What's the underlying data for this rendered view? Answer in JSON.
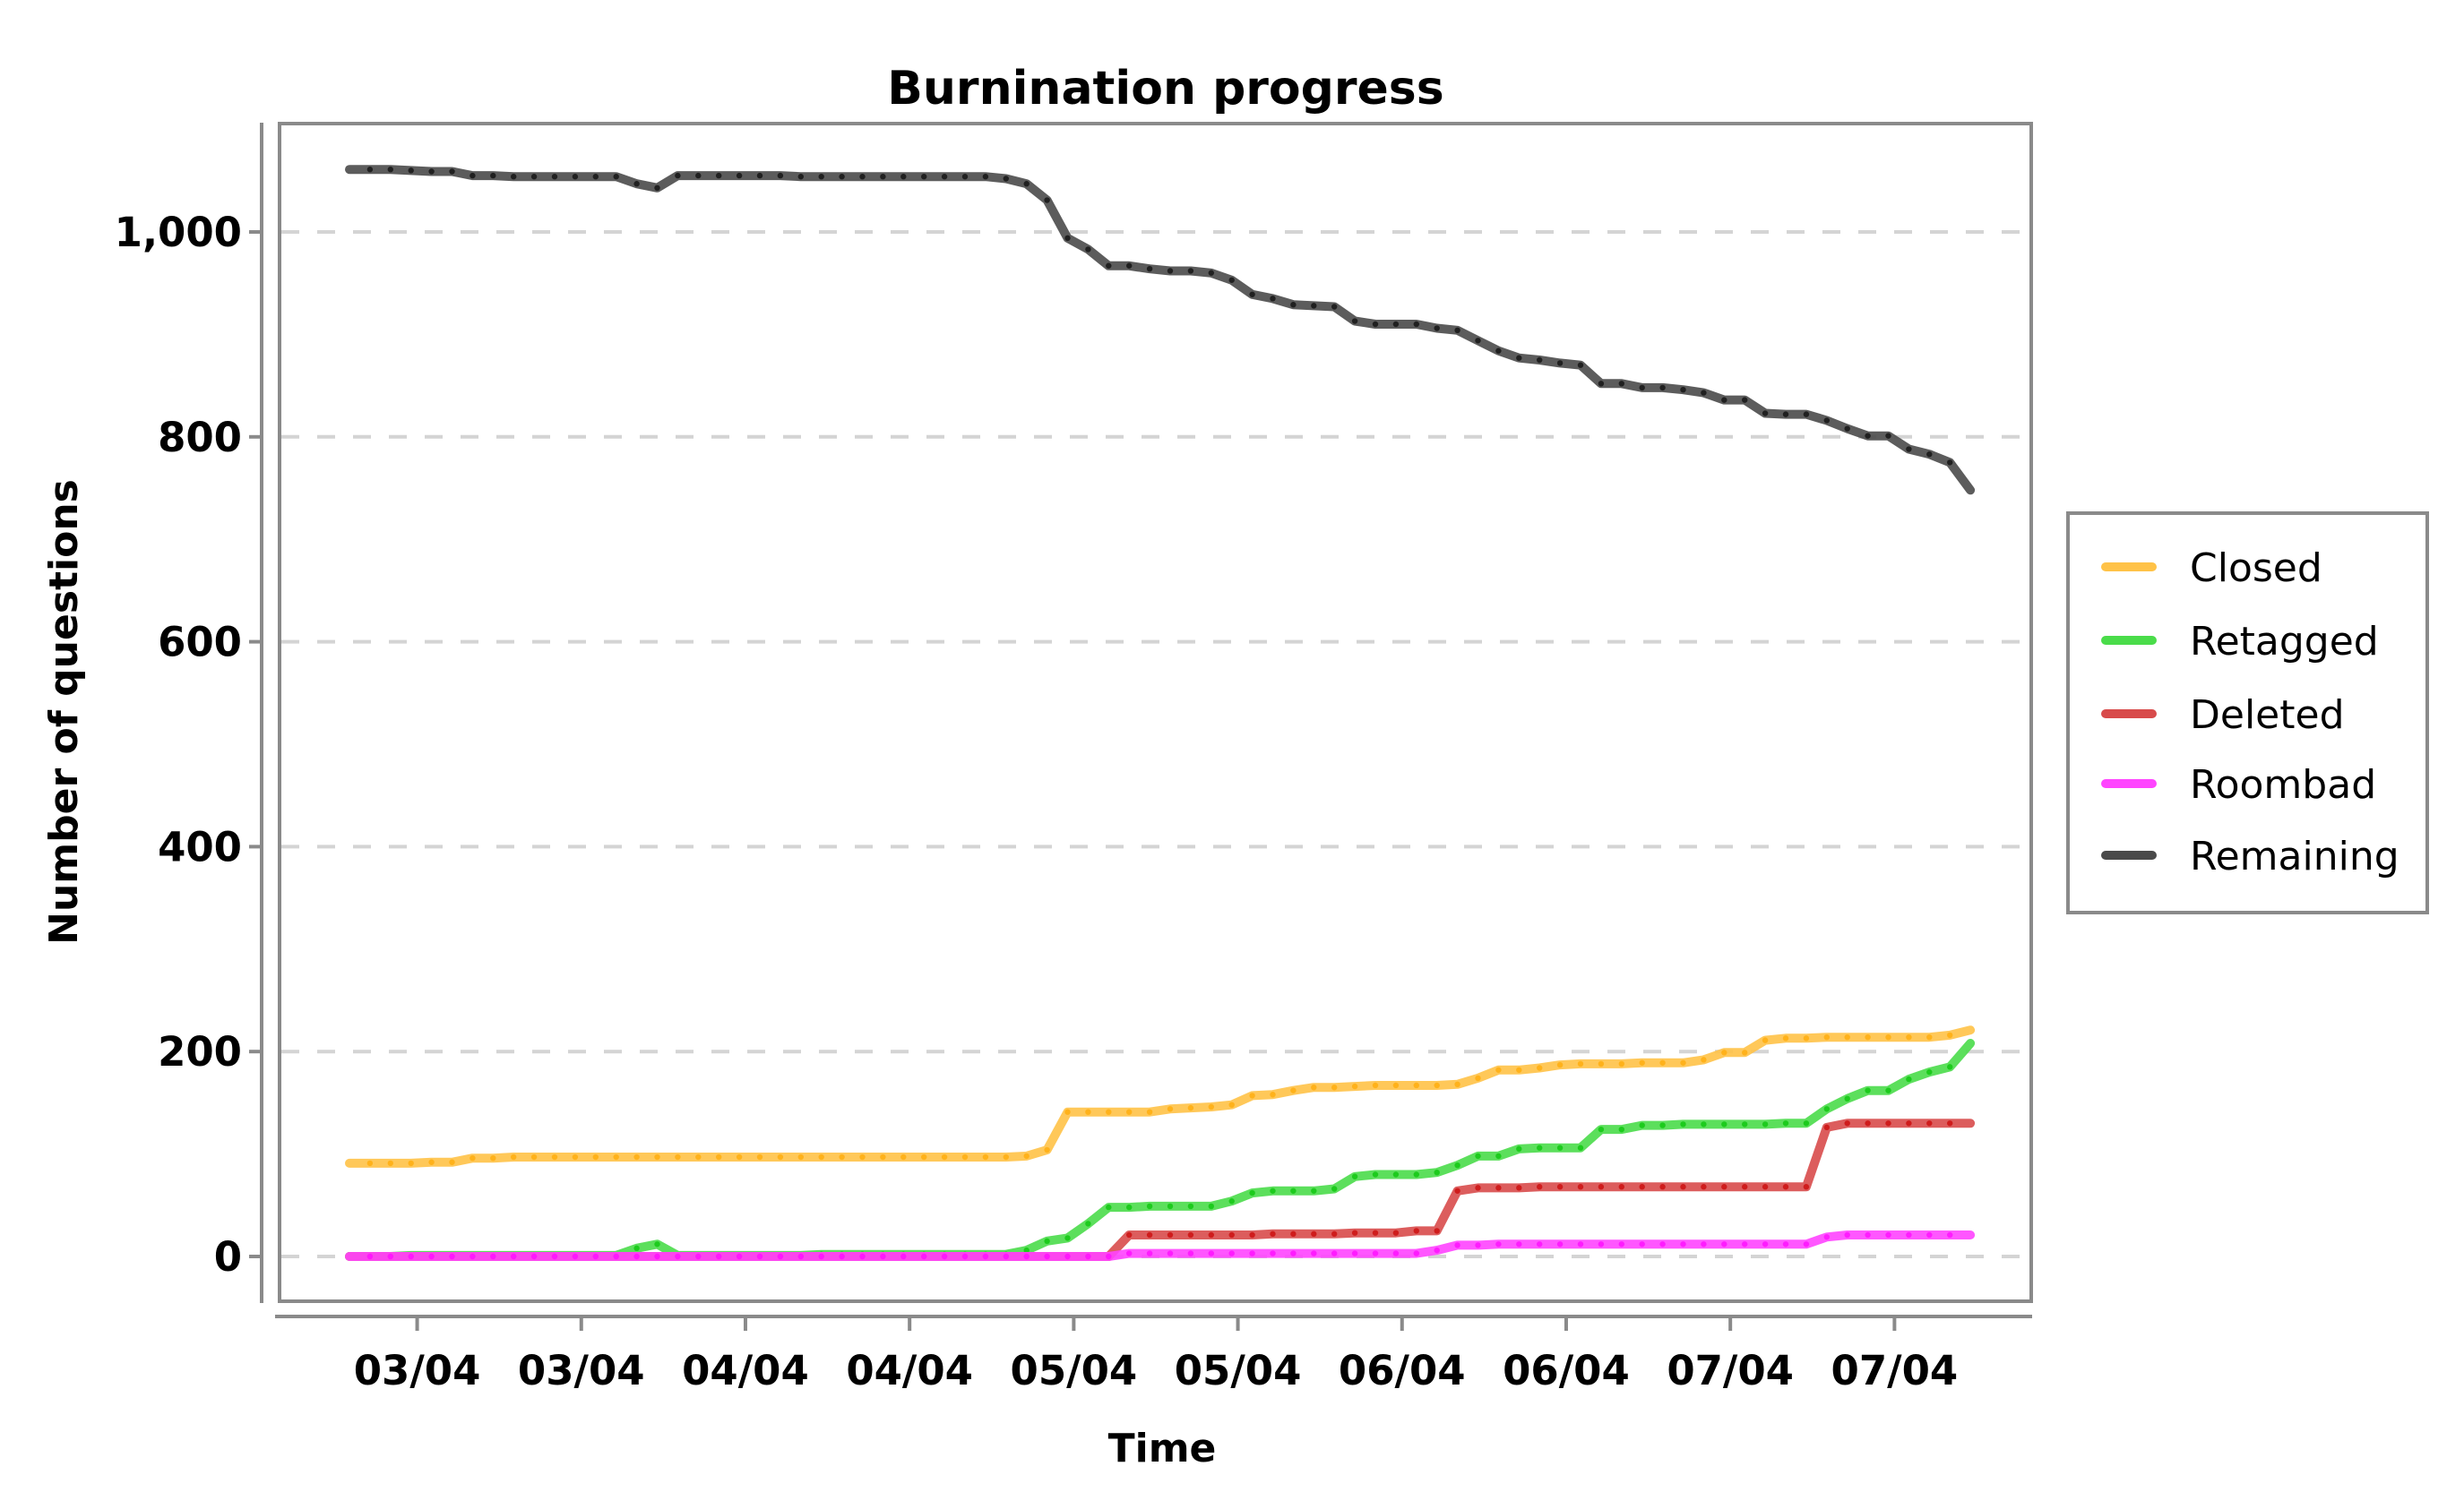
{
  "chart_data": {
    "type": "line",
    "title": "Burnination progress",
    "xlabel": "Time",
    "ylabel": "Number of questions",
    "ylim": [
      -60,
      1110
    ],
    "y_ticks": [
      0,
      200,
      400,
      600,
      800,
      1000
    ],
    "y_tick_labels": [
      "0",
      "200",
      "400",
      "600",
      "800",
      "1,000"
    ],
    "grid": "horizontal dashed",
    "x_points": 80,
    "x_ticks": [
      {
        "pos": 3.3,
        "label": "03/04"
      },
      {
        "pos": 11.3,
        "label": "03/04"
      },
      {
        "pos": 19.3,
        "label": "04/04"
      },
      {
        "pos": 27.3,
        "label": "04/04"
      },
      {
        "pos": 35.3,
        "label": "05/04"
      },
      {
        "pos": 43.3,
        "label": "05/04"
      },
      {
        "pos": 51.3,
        "label": "06/04"
      },
      {
        "pos": 59.3,
        "label": "06/04"
      },
      {
        "pos": 67.3,
        "label": "07/04"
      },
      {
        "pos": 75.3,
        "label": "07/04"
      }
    ],
    "legend_position": "right",
    "series": [
      {
        "name": "Closed",
        "color": "#FFC247",
        "marker_color": "#FFAE10",
        "values": [
          91,
          91,
          91,
          91,
          92,
          92,
          96,
          96,
          97,
          97,
          97,
          97,
          97,
          97,
          97,
          97,
          97,
          97,
          97,
          97,
          97,
          97,
          97,
          97,
          97,
          97,
          97,
          97,
          97,
          97,
          97,
          97,
          97,
          98,
          104,
          141,
          141,
          141,
          141,
          141,
          144,
          145,
          146,
          148,
          157,
          158,
          162,
          165,
          165,
          166,
          167,
          167,
          167,
          167,
          168,
          174,
          182,
          182,
          184,
          187,
          188,
          188,
          188,
          189,
          189,
          189,
          192,
          199,
          199,
          211,
          213,
          213,
          214,
          214,
          214,
          214,
          214,
          214,
          216,
          221
        ]
      },
      {
        "name": "Retagged",
        "color": "#4ADC4A",
        "marker_color": "#12C812",
        "values": [
          0,
          0,
          0,
          1,
          1,
          1,
          1,
          1,
          1,
          1,
          1,
          1,
          1,
          1,
          8,
          12,
          1,
          1,
          1,
          1,
          1,
          1,
          1,
          2,
          2,
          2,
          2,
          2,
          2,
          2,
          2,
          2,
          2,
          6,
          15,
          18,
          32,
          48,
          48,
          49,
          49,
          49,
          49,
          54,
          62,
          64,
          64,
          64,
          66,
          78,
          80,
          80,
          80,
          82,
          89,
          98,
          98,
          105,
          106,
          106,
          106,
          124,
          124,
          128,
          128,
          129,
          129,
          129,
          129,
          129,
          130,
          130,
          144,
          154,
          162,
          162,
          173,
          180,
          185,
          208
        ]
      },
      {
        "name": "Deleted",
        "color": "#D84B4B",
        "marker_color": "#CC1010",
        "values": [
          0,
          0,
          0,
          0,
          0,
          0,
          0,
          0,
          0,
          0,
          0,
          0,
          0,
          0,
          0,
          0,
          0,
          0,
          0,
          0,
          0,
          0,
          0,
          0,
          0,
          0,
          0,
          0,
          0,
          0,
          0,
          0,
          0,
          0,
          0,
          0,
          0,
          0,
          21,
          21,
          21,
          21,
          21,
          21,
          21,
          22,
          22,
          22,
          22,
          23,
          23,
          23,
          25,
          25,
          64,
          67,
          67,
          67,
          68,
          68,
          68,
          68,
          68,
          68,
          68,
          68,
          68,
          68,
          68,
          68,
          68,
          68,
          126,
          130,
          130,
          130,
          130,
          130,
          130,
          130
        ]
      },
      {
        "name": "Roombad",
        "color": "#FF44FF",
        "marker_color": "#FF10FF",
        "values": [
          0,
          0,
          0,
          0,
          0,
          0,
          0,
          0,
          0,
          0,
          0,
          0,
          0,
          0,
          0,
          0,
          0,
          0,
          0,
          0,
          0,
          0,
          0,
          0,
          0,
          0,
          0,
          0,
          0,
          0,
          0,
          0,
          0,
          0,
          0,
          0,
          0,
          0,
          3,
          3,
          3,
          3,
          3,
          3,
          3,
          3,
          3,
          3,
          3,
          3,
          3,
          3,
          3,
          6,
          11,
          11,
          12,
          12,
          12,
          12,
          12,
          12,
          12,
          12,
          12,
          12,
          12,
          12,
          12,
          12,
          12,
          12,
          19,
          21,
          21,
          21,
          21,
          21,
          21,
          21
        ]
      },
      {
        "name": "Remaining",
        "color": "#4A4A4A",
        "marker_color": "#151515",
        "values": [
          1061,
          1061,
          1061,
          1060,
          1059,
          1059,
          1055,
          1055,
          1054,
          1054,
          1054,
          1054,
          1054,
          1054,
          1047,
          1043,
          1055,
          1055,
          1055,
          1055,
          1055,
          1055,
          1054,
          1054,
          1054,
          1054,
          1054,
          1054,
          1054,
          1054,
          1054,
          1054,
          1052,
          1047,
          1031,
          994,
          983,
          967,
          967,
          964,
          962,
          962,
          960,
          953,
          939,
          935,
          929,
          928,
          927,
          913,
          910,
          910,
          910,
          906,
          904,
          894,
          884,
          877,
          875,
          872,
          870,
          852,
          852,
          848,
          848,
          846,
          843,
          836,
          836,
          823,
          822,
          822,
          816,
          808,
          801,
          801,
          788,
          783,
          775,
          748
        ]
      }
    ],
    "draw_order": [
      "Remaining",
      "Closed",
      "Retagged",
      "Deleted",
      "Roombad"
    ]
  }
}
